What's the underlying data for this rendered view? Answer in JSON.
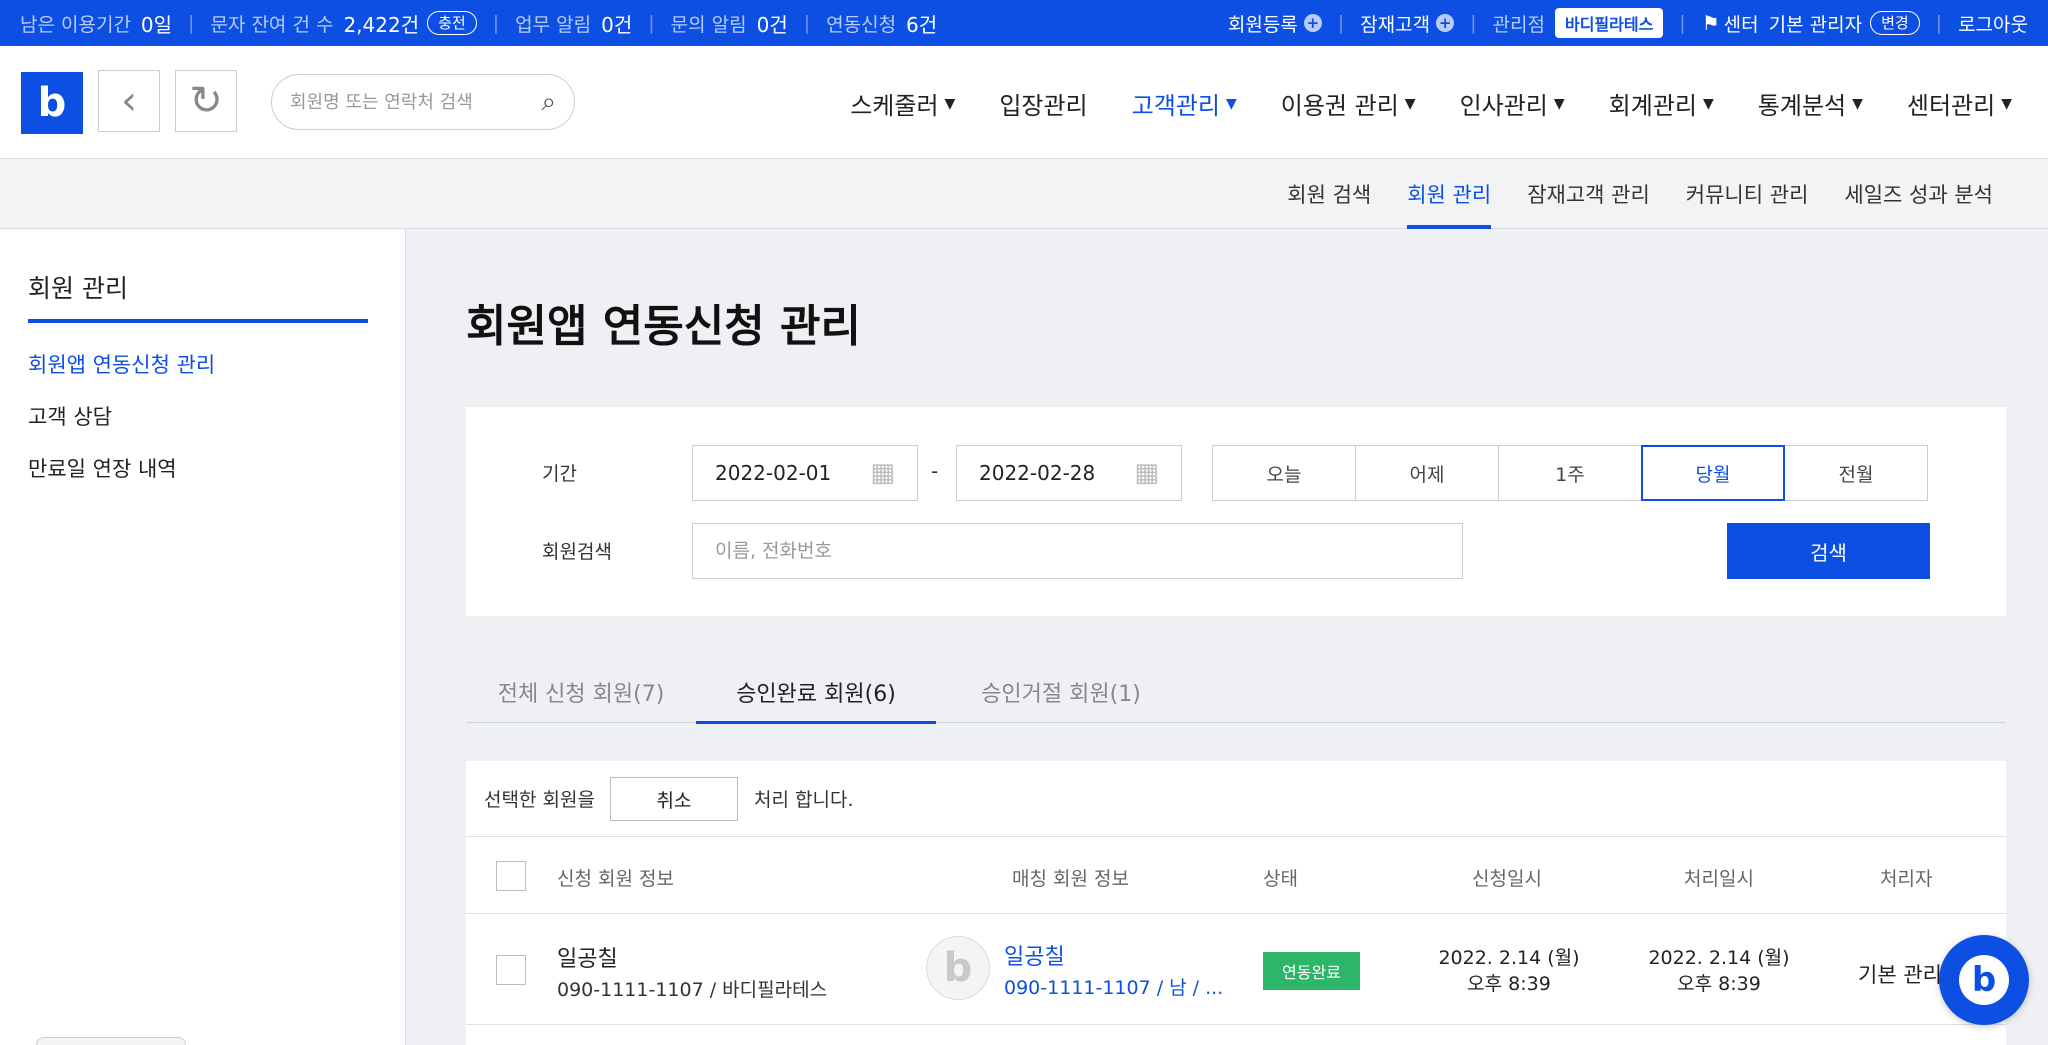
{
  "topbar": {
    "remaining_label": "남은 이용기간",
    "remaining_value": "0일",
    "sms_label": "문자 잔여 건 수",
    "sms_value": "2,422건",
    "charge_label": "충전",
    "task_label": "업무 알림",
    "task_value": "0건",
    "inquiry_label": "문의 알림",
    "inquiry_value": "0건",
    "link_label": "연동신청",
    "link_value": "6건",
    "member_register": "회원등록",
    "prospect": "잠재고객",
    "branch_label": "관리점",
    "branch_value": "바디필라테스",
    "center_label": "센터",
    "admin_label": "기본 관리자",
    "change_label": "변경",
    "logout": "로그아웃"
  },
  "header": {
    "logo_letter": "b",
    "search_placeholder": "회원명 또는 연락처 검색",
    "nav": [
      "스케줄러",
      "입장관리",
      "고객관리",
      "이용권 관리",
      "인사관리",
      "회계관리",
      "통계분석",
      "센터관리"
    ]
  },
  "subnav": [
    "회원 검색",
    "회원 관리",
    "잠재고객 관리",
    "커뮤니티 관리",
    "세일즈 성과 분석"
  ],
  "sidebar": {
    "title": "회원 관리",
    "links": [
      "회원앱 연동신청 관리",
      "고객 상담",
      "만료일 연장 내역"
    ]
  },
  "page": {
    "title": "회원앱 연동신청 관리"
  },
  "filter": {
    "period_label": "기간",
    "start_date": "2022-02-01",
    "end_date": "2022-02-28",
    "dash": "-",
    "periods": [
      "오늘",
      "어제",
      "1주",
      "당월",
      "전월"
    ],
    "member_search_label": "회원검색",
    "member_search_placeholder": "이름, 전화번호",
    "search_button": "검색"
  },
  "tabs": [
    "전체 신청 회원(7)",
    "승인완료 회원(6)",
    "승인거절 회원(1)"
  ],
  "table": {
    "action_prefix": "선택한 회원을",
    "action_button": "취소",
    "action_suffix": "처리 합니다.",
    "headers": [
      "신청 회원 정보",
      "매칭 회원 정보",
      "상태",
      "신청일시",
      "처리일시",
      "처리자"
    ],
    "rows": [
      {
        "name": "일공칠",
        "detail": "090-1111-1107 / 바디필라테스",
        "match_name": "일공칠",
        "match_detail": "090-1111-1107 / 남 / ...",
        "status": "연동완료",
        "apply_date": "2022. 2.14 (월)",
        "apply_time": "오후 8:39",
        "process_date": "2022. 2.14 (월)",
        "process_time": "오후 8:39",
        "handler": "기본 관리"
      }
    ]
  },
  "colors": {
    "primary": "#0d4fe2",
    "status_green": "#2db66a"
  }
}
